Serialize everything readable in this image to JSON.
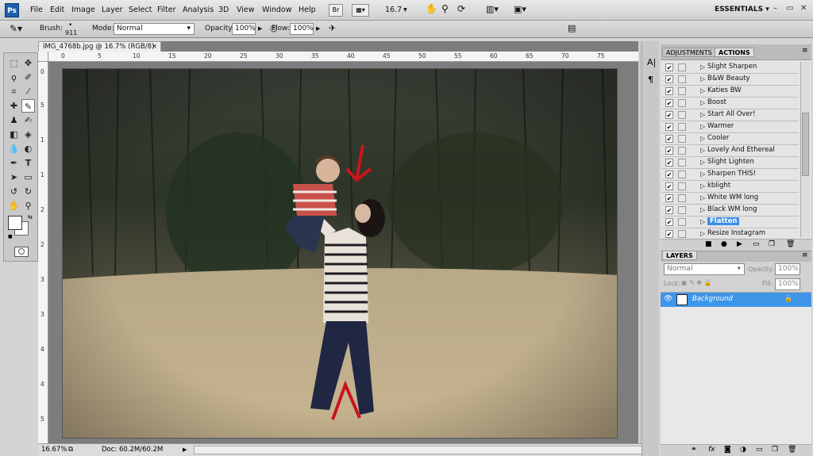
{
  "menubar": {
    "logo": "Ps",
    "items": [
      "File",
      "Edit",
      "Image",
      "Layer",
      "Select",
      "Filter",
      "Analysis",
      "3D",
      "View",
      "Window",
      "Help"
    ],
    "br": "Br",
    "zoom": "16.7",
    "workspace": "ESSENTIALS ▾",
    "min": "–",
    "max": "▭",
    "close": "✕"
  },
  "options": {
    "brush_label": "Brush:",
    "brush_size": "911",
    "mode_label": "Mode:",
    "mode_value": "Normal",
    "opacity_label": "Opacity:",
    "opacity_value": "100%",
    "flow_label": "Flow:",
    "flow_value": "100%"
  },
  "document": {
    "tab_title": "IMG_4768b.jpg @ 16.7% (RGB/8)",
    "tab_close": "×",
    "ruler_h": [
      "0",
      "5",
      "10",
      "15",
      "20",
      "25",
      "30",
      "35",
      "40",
      "45",
      "50",
      "55",
      "60",
      "65",
      "70",
      "75"
    ],
    "ruler_v": [
      "0",
      "5",
      "1",
      "1",
      "2",
      "2",
      "3",
      "3",
      "4",
      "4",
      "5"
    ]
  },
  "status": {
    "zoom": "16.67%",
    "doc": "Doc: 60.2M/60.2M"
  },
  "actions_panel": {
    "tab_adjustments": "ADJUSTMENTS",
    "tab_actions": "ACTIONS",
    "items": [
      "Slight Sharpen",
      "B&W Beauty",
      "Katies BW",
      "Boost",
      "Start All Over!",
      "Warmer",
      "Cooler",
      "Lovely And Ethereal",
      "Slight Lighten",
      "Sharpen THIS!",
      "kblight",
      "White WM long",
      "Black WM long",
      "Flatten",
      "Resize Instagram"
    ],
    "selected": "Flatten"
  },
  "layers_panel": {
    "tab": "LAYERS",
    "blend": "Normal",
    "opacity_label": "Opacity:",
    "opacity_value": "100%",
    "lock_label": "Lock:",
    "fill_label": "Fill:",
    "fill_value": "100%",
    "layer_name": "Background"
  },
  "colors": {
    "accent": "#3d8ee8",
    "annotation": "#c8141e"
  }
}
